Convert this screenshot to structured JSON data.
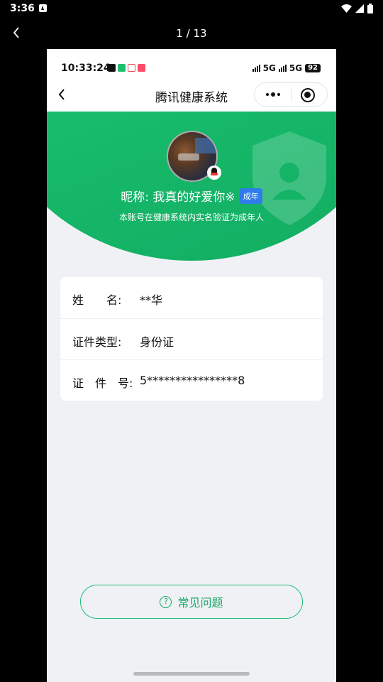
{
  "system_bar": {
    "time": "3:36"
  },
  "viewer": {
    "page_counter": "1 / 13"
  },
  "screenshot": {
    "status": {
      "time": "10:33:24",
      "network1": "5G",
      "network2": "5G",
      "battery": "92"
    },
    "nav": {
      "title": "腾讯健康系统"
    },
    "profile": {
      "nickname": "昵称: 我真的好爱你※",
      "tag": "成年",
      "verify_text": "本账号在健康系统内实名验证为成年人"
    },
    "info_rows": [
      {
        "label": "姓　　名:",
        "value": "**华"
      },
      {
        "label": "证件类型:",
        "value": "身份证"
      },
      {
        "label": "证　件　号:",
        "value": "5****************8"
      }
    ],
    "faq_button": {
      "label": "常见问题"
    }
  },
  "colors": {
    "brand_green": "#1fbe73",
    "tag_blue": "#2f7bea",
    "page_bg": "#eff1f5"
  },
  "icons": [
    "back-arrow-icon",
    "more-dots-icon",
    "close-mini-program-icon",
    "shield-icon",
    "qq-icon",
    "question-icon"
  ]
}
